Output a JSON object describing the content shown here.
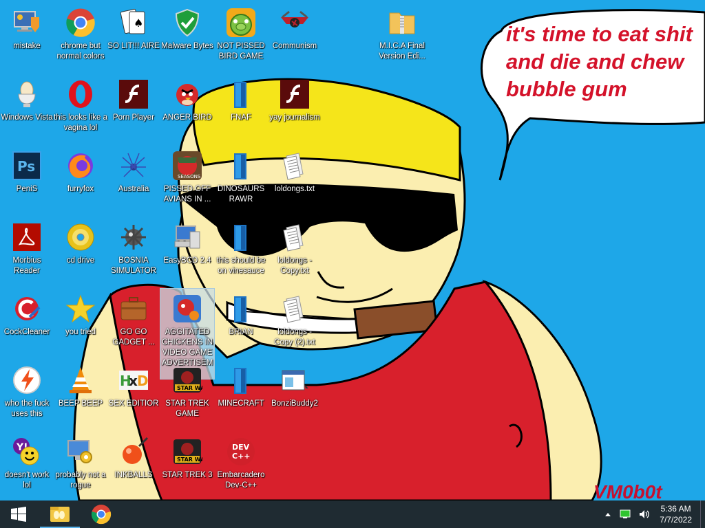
{
  "desktop": {
    "bubble_text": "it's time to eat shit and die and chew bubble gum",
    "signature": "VM0b0t",
    "icons": [
      {
        "label": "mistake",
        "icon": "monitor-upgrade-icon"
      },
      {
        "label": "chrome but normal colors",
        "icon": "chrome-icon"
      },
      {
        "label": "SO LIT!!! AIRE",
        "icon": "solitaire-cards-icon"
      },
      {
        "label": "Malware Bytes",
        "icon": "shield-check-icon"
      },
      {
        "label": "NOT PISSED BIRD GAME",
        "icon": "green-pig-icon"
      },
      {
        "label": "Communism",
        "icon": "hammer-sickle-icon"
      },
      {
        "label": "M.I.C.A Final Version Edi...",
        "icon": "zip-folder-icon"
      },
      {
        "label": "Windows Vista",
        "icon": "egg-cup-icon"
      },
      {
        "label": "this looks like a vagina lol",
        "icon": "opera-icon"
      },
      {
        "label": "Porn Player",
        "icon": "flash-icon"
      },
      {
        "label": "ANGER BIRD",
        "icon": "red-bird-icon"
      },
      {
        "label": "FNAF",
        "icon": "blue-file-icon"
      },
      {
        "label": "yay journalism",
        "icon": "flash-icon"
      },
      {
        "label": "PeniS",
        "icon": "photoshop-icon"
      },
      {
        "label": "furryfox",
        "icon": "firefox-icon"
      },
      {
        "label": "Australia",
        "icon": "spider-solitaire-icon"
      },
      {
        "label": "PISSED OFF AVIANS IN ...",
        "icon": "seasons-bird-icon"
      },
      {
        "label": "DINOSAURS RAWR",
        "icon": "blue-file-icon"
      },
      {
        "label": "loldongs.txt",
        "icon": "text-file-icon"
      },
      {
        "label": "Morbius Reader",
        "icon": "pdf-reader-icon"
      },
      {
        "label": "cd drive",
        "icon": "cd-icon"
      },
      {
        "label": "BOSNIA SIMULATOR",
        "icon": "mine-icon"
      },
      {
        "label": "EasyBCD 2.4",
        "icon": "computer-icon"
      },
      {
        "label": "this should be on vinesauce",
        "icon": "blue-file-icon"
      },
      {
        "label": "loldongs - Copy.txt",
        "icon": "text-file-icon"
      },
      {
        "label": "CockCleaner",
        "icon": "ccleaner-icon"
      },
      {
        "label": "you tried",
        "icon": "star-icon"
      },
      {
        "label": "GO GO GADGET ...",
        "icon": "briefcase-icon"
      },
      {
        "label": "AGGITATED CHICKENS IN VIDEO GAME ADVERTISEMENT",
        "icon": "bird-ad-icon"
      },
      {
        "label": "BRIAN",
        "icon": "blue-file-icon"
      },
      {
        "label": "loldongs - Copy (2).txt",
        "icon": "text-file-icon"
      },
      {
        "label": "who the fuck uses this",
        "icon": "lightning-icon"
      },
      {
        "label": "BEEP BEEP",
        "icon": "vlc-cone-icon"
      },
      {
        "label": "SEX EDITIOR",
        "icon": "hxd-icon"
      },
      {
        "label": "STAR TREK GAME",
        "icon": "star-wars-icon"
      },
      {
        "label": "MINECRAFT",
        "icon": "blue-file-icon"
      },
      {
        "label": "BonziBuddy2",
        "icon": "window-app-icon"
      },
      {
        "label": "doesn't work lol",
        "icon": "yahoo-messenger-icon"
      },
      {
        "label": "probably not a rogue",
        "icon": "gears-monitor-icon"
      },
      {
        "label": "INKBALLS",
        "icon": "ink-ball-icon"
      },
      {
        "label": "STAR TREK 3",
        "icon": "star-wars-icon"
      },
      {
        "label": "Embarcadero Dev-C++",
        "icon": "devcpp-icon"
      }
    ]
  },
  "taskbar": {
    "start_icon": "windows-logo-icon",
    "pinned": [
      {
        "icon": "file-explorer-icon"
      },
      {
        "icon": "chrome-icon"
      }
    ],
    "time": "5:36 AM",
    "date": "7/7/2022"
  }
}
